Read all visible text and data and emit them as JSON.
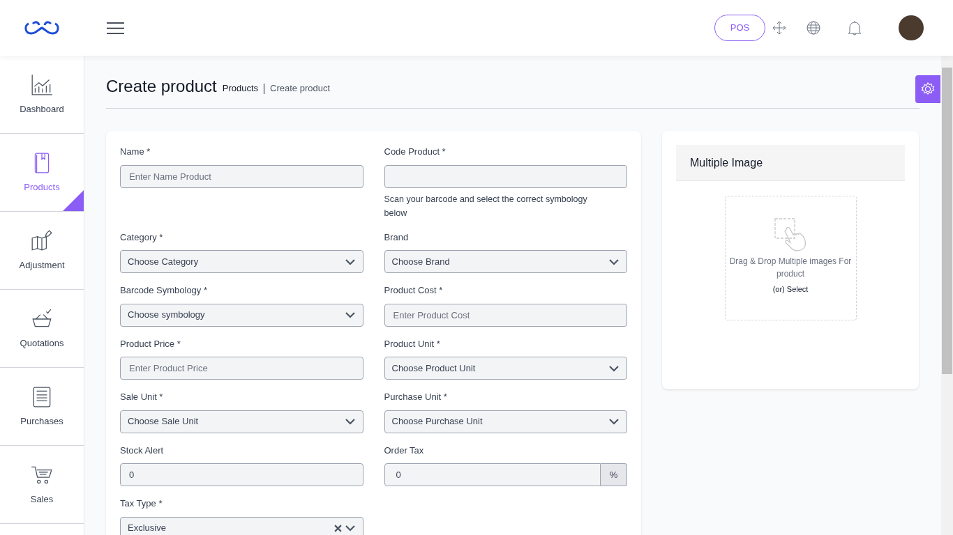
{
  "header": {
    "pos_button": "POS"
  },
  "sidebar": {
    "items": [
      {
        "label": "Dashboard",
        "selected": false
      },
      {
        "label": "Products",
        "selected": true
      },
      {
        "label": "Adjustment",
        "selected": false
      },
      {
        "label": "Quotations",
        "selected": false
      },
      {
        "label": "Purchases",
        "selected": false
      },
      {
        "label": "Sales",
        "selected": false
      }
    ]
  },
  "page": {
    "title": "Create product",
    "breadcrumb": [
      "Products",
      "Create product"
    ]
  },
  "form": {
    "fields": [
      {
        "label": "Name *",
        "kind": "input",
        "placeholder": "Enter Name Product"
      },
      {
        "label": "Code Product *",
        "kind": "input",
        "help": "Scan your barcode and select the correct symbology below"
      },
      {
        "label": "Category *",
        "kind": "select",
        "value": "Choose Category"
      },
      {
        "label": "Brand",
        "kind": "select",
        "value": "Choose Brand"
      },
      {
        "label": "Barcode Symbology *",
        "kind": "select",
        "value": "Choose symbology"
      },
      {
        "label": "Product Cost *",
        "kind": "input",
        "placeholder": "Enter Product Cost"
      },
      {
        "label": "Product Price *",
        "kind": "input",
        "placeholder": "Enter Product Price"
      },
      {
        "label": "Product Unit *",
        "kind": "select",
        "value": "Choose Product Unit"
      },
      {
        "label": "Sale Unit *",
        "kind": "select",
        "value": "Choose Sale Unit"
      },
      {
        "label": "Purchase Unit *",
        "kind": "select",
        "value": "Choose Purchase Unit"
      },
      {
        "label": "Stock Alert",
        "kind": "input",
        "value": "0"
      },
      {
        "label": "Order Tax",
        "kind": "addon",
        "value": "0",
        "addon": "%"
      },
      {
        "label": "Tax Type *",
        "kind": "select",
        "value": "Exclusive",
        "clearable": true
      }
    ]
  },
  "images": {
    "title": "Multiple Image",
    "drop_text": "Drag & Drop Multiple images For product",
    "select_text": "(or) Select"
  }
}
